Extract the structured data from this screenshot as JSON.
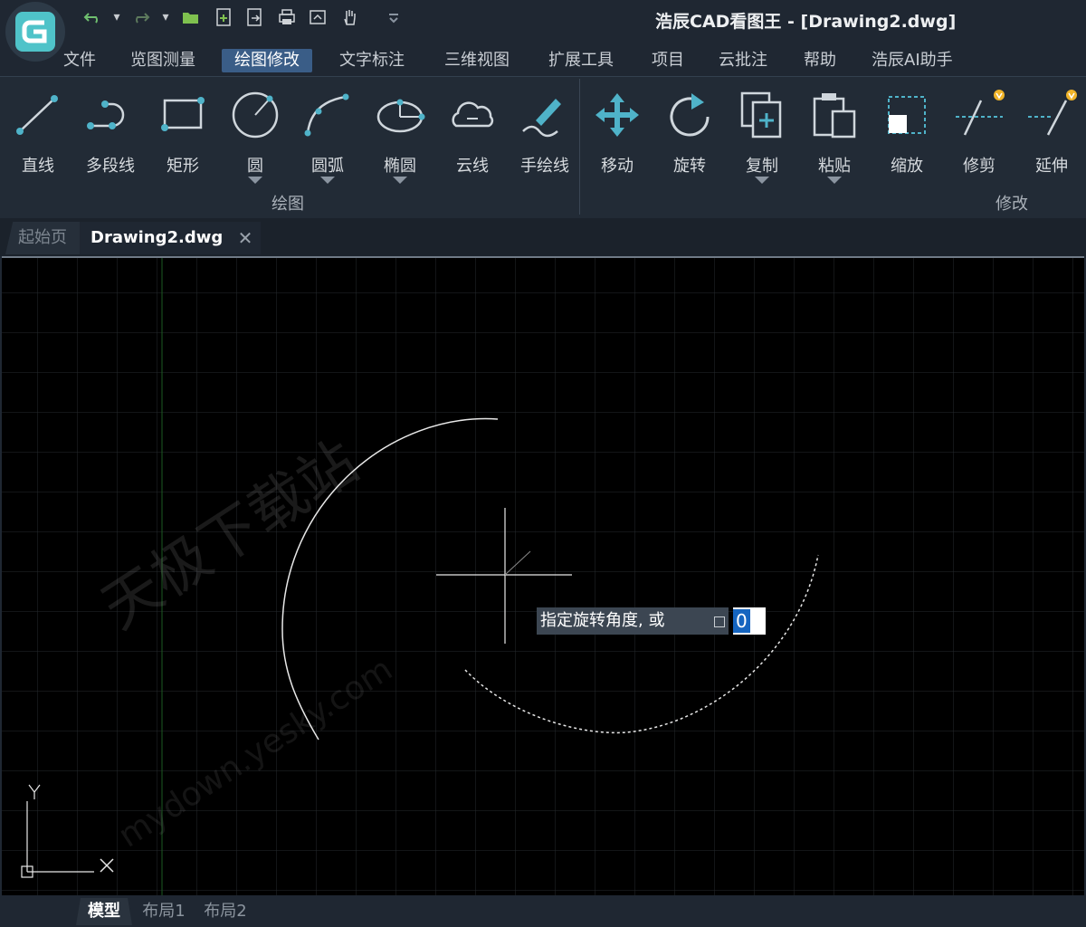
{
  "app": {
    "title": "浩辰CAD看图王 - [Drawing2.dwg]",
    "logo_icon": "app-logo-icon",
    "accent": "#3a5d87"
  },
  "quick_access": {
    "icons": [
      "undo-icon",
      "undo-dropdown-icon",
      "redo-icon",
      "redo-dropdown-icon",
      "open-folder-icon",
      "new-file-icon",
      "save-as-icon",
      "print-icon",
      "publish-icon",
      "pan-hand-icon",
      "customize-dropdown-icon"
    ]
  },
  "menu": {
    "items": [
      "文件",
      "览图测量",
      "绘图修改",
      "文字标注",
      "三维视图",
      "扩展工具",
      "项目",
      "云批注",
      "帮助",
      "浩辰AI助手"
    ],
    "active": "绘图修改"
  },
  "ribbon": {
    "draw_group": {
      "label": "绘图",
      "tools": [
        {
          "label": "直线",
          "icon": "line-icon"
        },
        {
          "label": "多段线",
          "icon": "polyline-icon"
        },
        {
          "label": "矩形",
          "icon": "rectangle-icon"
        },
        {
          "label": "圆",
          "icon": "circle-icon"
        },
        {
          "label": "圆弧",
          "icon": "arc-icon"
        },
        {
          "label": "椭圆",
          "icon": "ellipse-icon"
        },
        {
          "label": "云线",
          "icon": "revcloud-icon"
        },
        {
          "label": "手绘线",
          "icon": "freehand-icon"
        }
      ]
    },
    "modify_group": {
      "label": "修改",
      "tools": [
        {
          "label": "移动",
          "icon": "move-icon"
        },
        {
          "label": "旋转",
          "icon": "rotate-icon"
        },
        {
          "label": "复制",
          "icon": "copy-icon"
        },
        {
          "label": "粘贴",
          "icon": "paste-icon"
        },
        {
          "label": "缩放",
          "icon": "scale-icon"
        },
        {
          "label": "修剪",
          "icon": "trim-icon"
        },
        {
          "label": "延伸",
          "icon": "extend-icon"
        }
      ]
    }
  },
  "tabs": {
    "start": "起始页",
    "drawing": "Drawing2.dwg",
    "close": "✕"
  },
  "canvas": {
    "watermark_cn": "天极下载站",
    "watermark_url": "mydown.yesky.com",
    "prompt_text": "指定旋转角度, 或",
    "angle_value": "0",
    "ucs_x": "X",
    "ucs_y": "Y",
    "background": "#000000"
  },
  "layout_tabs": [
    "模型",
    "布局1",
    "布局2"
  ]
}
